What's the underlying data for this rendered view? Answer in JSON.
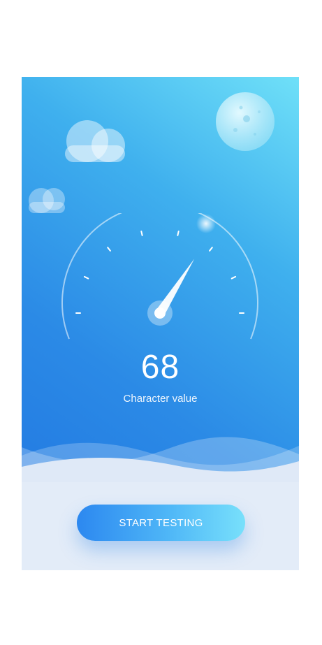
{
  "gauge": {
    "value": "68",
    "label": "Character value",
    "needle_level_percent": 68
  },
  "action": {
    "start_label": "START TESTING"
  },
  "colors": {
    "sky_top": "#6fe0f8",
    "sky_bottom": "#1f74e0",
    "ground": "#e3ecf8",
    "button_start": "#2c88f0",
    "button_end": "#78e0fb"
  },
  "icons": {
    "moon": "moon-icon",
    "cloud": "cloud-icon"
  }
}
